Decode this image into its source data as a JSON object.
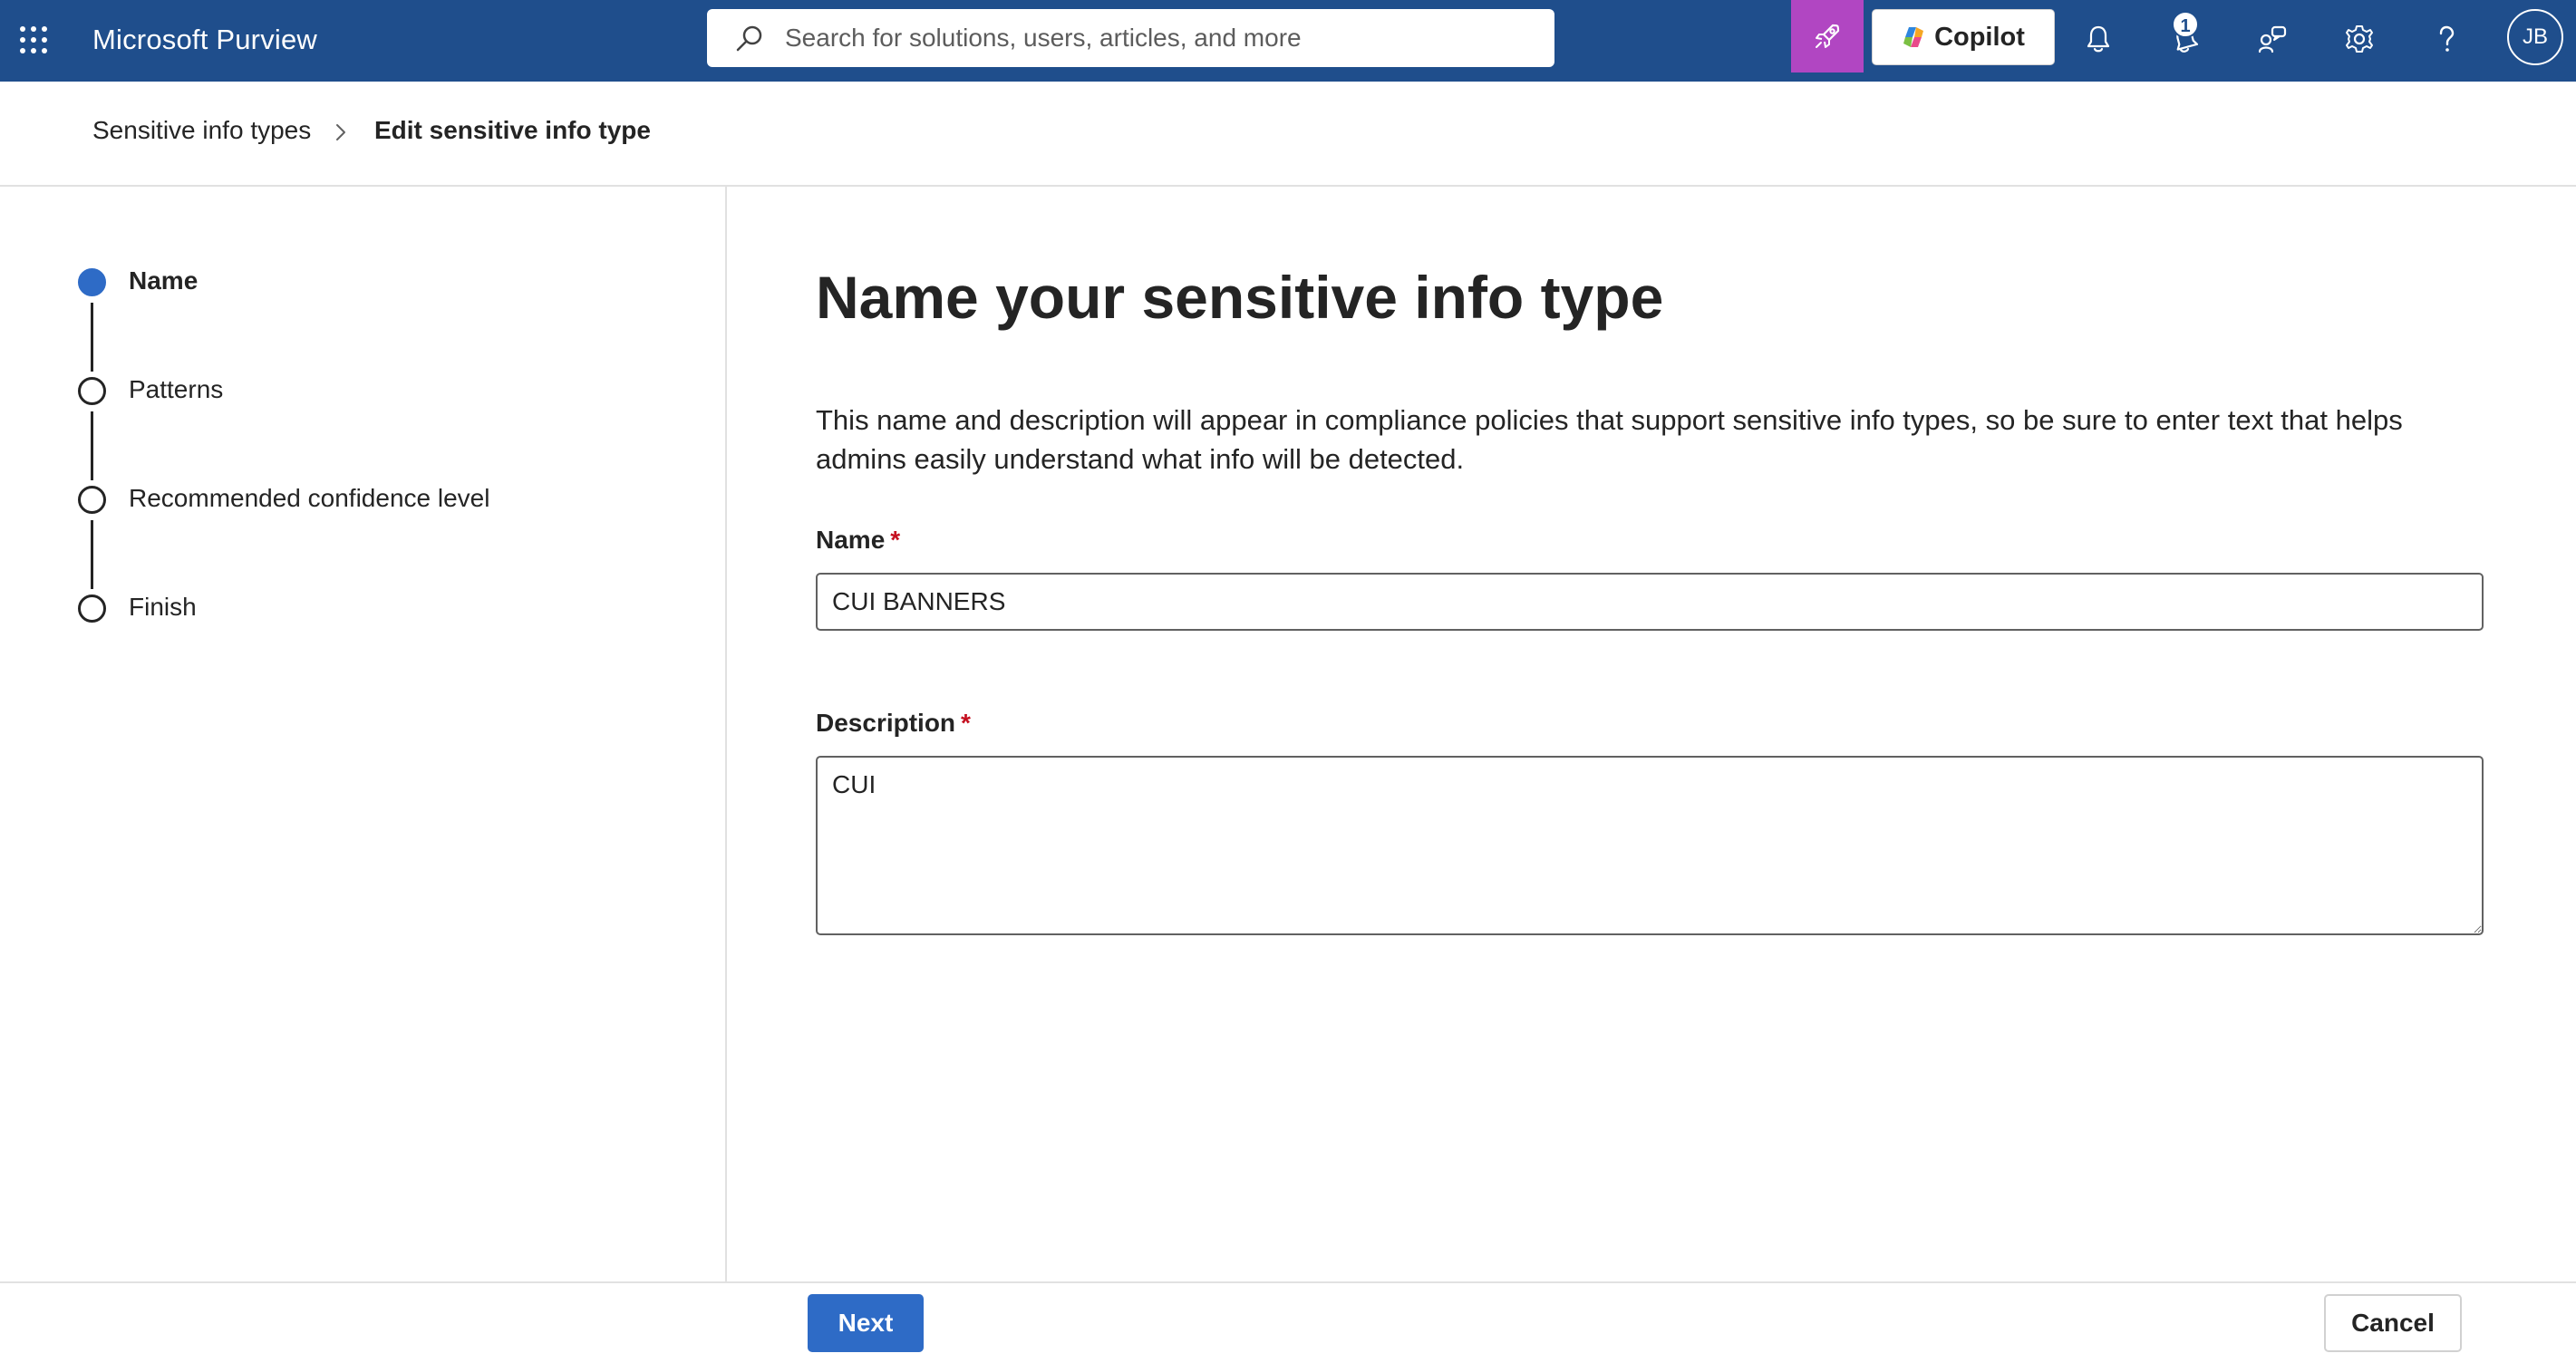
{
  "topbar": {
    "app_title": "Microsoft Purview",
    "search_placeholder": "Search for solutions, users, articles, and more",
    "copilot_label": "Copilot",
    "notification_count": "1",
    "avatar_initials": "JB",
    "colors": {
      "bar": "#1f4e8c",
      "rocket_button": "#b146c2"
    },
    "icons": [
      "app-launcher-icon",
      "search-icon",
      "rocket-icon",
      "copilot-logo-icon",
      "bell-icon",
      "alert-bell-icon",
      "feedback-icon",
      "gear-icon",
      "help-icon"
    ]
  },
  "breadcrumb": {
    "parent": "Sensitive info types",
    "current": "Edit sensitive info type"
  },
  "stepper": {
    "steps": [
      {
        "label": "Name",
        "active": true
      },
      {
        "label": "Patterns",
        "active": false
      },
      {
        "label": "Recommended confidence level",
        "active": false
      },
      {
        "label": "Finish",
        "active": false
      }
    ],
    "active_color": "#2e6bc6"
  },
  "main": {
    "title": "Name your sensitive info type",
    "description": "This name and description will appear in compliance policies that support sensitive info types, so be sure to enter text that helps admins easily understand what info will be detected.",
    "name_label": "Name",
    "name_value": "CUI BANNERS",
    "description_label": "Description",
    "description_value": "CUI",
    "required_marker": "*"
  },
  "footer": {
    "next_label": "Next",
    "cancel_label": "Cancel"
  }
}
